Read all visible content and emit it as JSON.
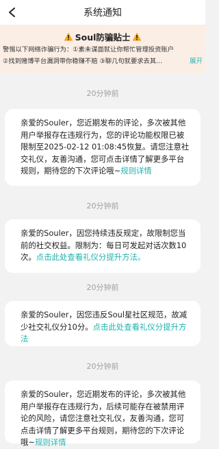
{
  "header": {
    "title": "系统通知"
  },
  "notice": {
    "title": "Soul防骗贴士",
    "line1": "警惕以下网络诈骗行为：①素未谋面就让你帮忙管理投资账户",
    "line2": "②找到赌博平台漏洞带你稳赚不赔 ③聊几句就要求去其...",
    "expand_label": "展开",
    "colors": {
      "background": "#fbeee5",
      "accent": "#2bb7b3",
      "warning": "#f5a623"
    }
  },
  "feed": {
    "items": [
      {
        "time": "20分钟前",
        "text": "亲爱的Souler，您近期发布的评论，多次被其他用户举报存在违规行为，您的评论功能权限已被限制至2025-02-12 01:08:45恢复。请您注意社交礼仪，友善沟通，您可点击详情了解更多平台规则，期待您的下次评论哦~",
        "link": "规则详情"
      },
      {
        "time": "20分钟前",
        "text": "亲爱的Souler，因您持续违反规定，故限制您当前的社交权益。限制为：每日可发起对话次数10次。",
        "link": "点击此处查看礼仪分提升方法。"
      },
      {
        "time": "20分钟前",
        "text": "亲爱的Souler，因您违反Soul星社区规范，故减少社交礼仪分10分。",
        "link": "点击此处查看礼仪分提升方法"
      },
      {
        "time": "20分钟前",
        "text": "亲爱的Souler，您近期发布的评论，多次被其他用户举报存在违规行为，后续可能存在被禁用评论的风险，请您注意社交礼仪，友善沟通，您可点击详情了解更多平台规则，期待您的下次评论哦~",
        "link": "规则详情"
      }
    ],
    "link_color": "#1fb3ad"
  }
}
